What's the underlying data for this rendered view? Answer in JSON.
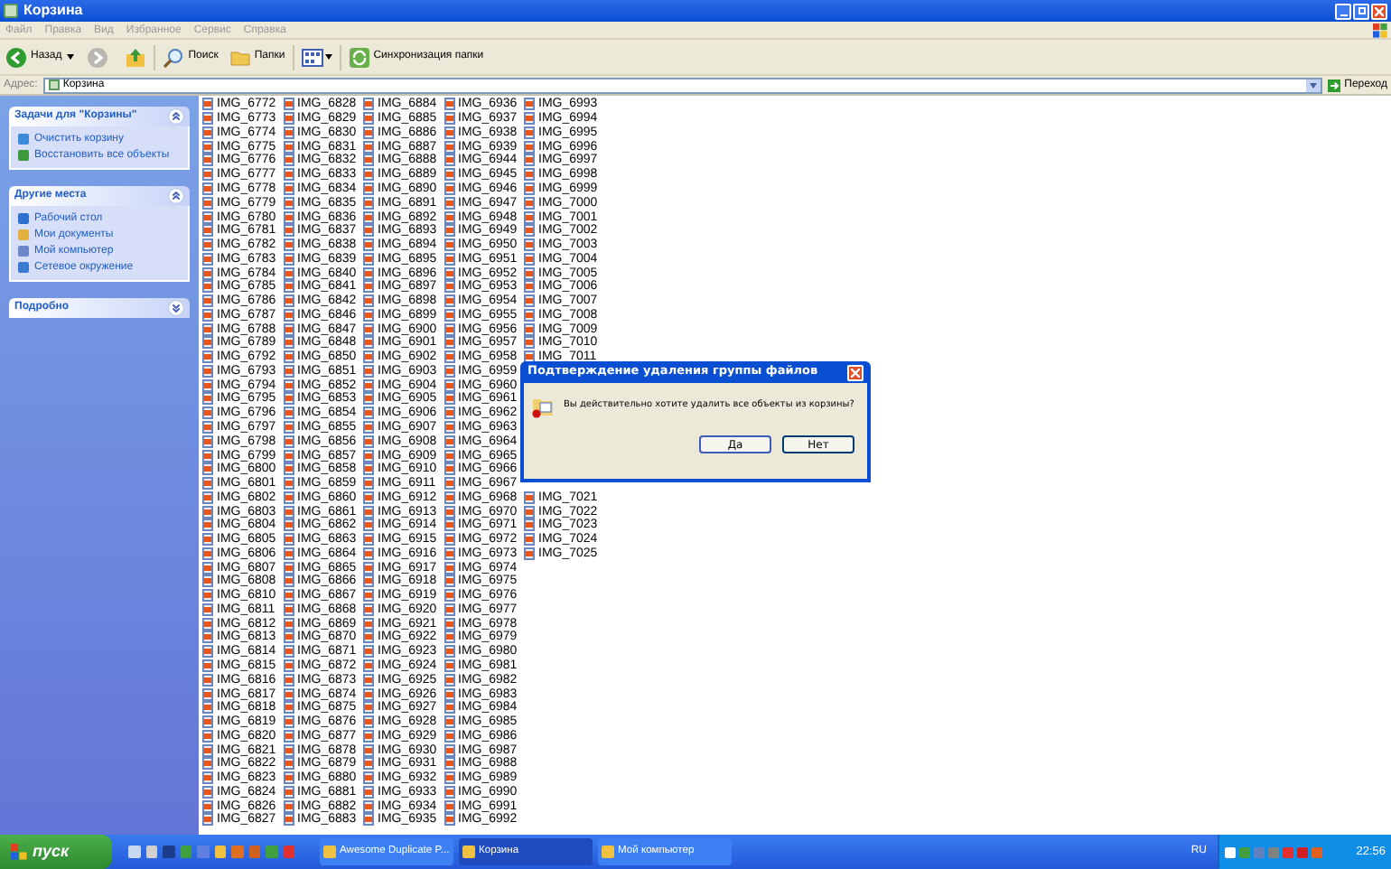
{
  "window": {
    "title": "Корзина"
  },
  "menu": [
    "Файл",
    "Правка",
    "Вид",
    "Избранное",
    "Сервис",
    "Справка"
  ],
  "toolbar": {
    "back": "Назад",
    "search": "Поиск",
    "folders": "Папки",
    "sync": "Синхронизация папки"
  },
  "address": {
    "label": "Адрес:",
    "value": "Корзина",
    "go": "Переход"
  },
  "sidebar": [
    {
      "title": "Задачи для \"Корзины\"",
      "expanded": true,
      "items": [
        "Очистить корзину",
        "Восстановить все объекты"
      ]
    },
    {
      "title": "Другие места",
      "expanded": true,
      "items": [
        "Рабочий стол",
        "Мои документы",
        "Мой компьютер",
        "Сетевое окружение"
      ]
    },
    {
      "title": "Подробно",
      "expanded": false
    }
  ],
  "columns": [
    {
      "files": [
        "IMG_6772",
        "IMG_6773",
        "IMG_6774",
        "IMG_6775",
        "IMG_6776",
        "IMG_6777",
        "IMG_6778",
        "IMG_6779",
        "IMG_6780",
        "IMG_6781",
        "IMG_6782",
        "IMG_6783",
        "IMG_6784",
        "IMG_6785",
        "IMG_6786",
        "IMG_6787",
        "IMG_6788",
        "IMG_6789",
        "IMG_6792",
        "IMG_6793",
        "IMG_6794",
        "IMG_6795",
        "IMG_6796",
        "IMG_6797",
        "IMG_6798",
        "IMG_6799",
        "IMG_6800",
        "IMG_6801",
        "IMG_6802",
        "IMG_6803",
        "IMG_6804",
        "IMG_6805",
        "IMG_6806",
        "IMG_6807",
        "IMG_6808",
        "IMG_6810",
        "IMG_6811",
        "IMG_6812",
        "IMG_6813",
        "IMG_6814",
        "IMG_6815",
        "IMG_6816",
        "IMG_6817",
        "IMG_6818",
        "IMG_6819",
        "IMG_6820",
        "IMG_6821",
        "IMG_6822",
        "IMG_6823",
        "IMG_6824",
        "IMG_6826",
        "IMG_6827"
      ]
    },
    {
      "files": [
        "IMG_6828",
        "IMG_6829",
        "IMG_6830",
        "IMG_6831",
        "IMG_6832",
        "IMG_6833",
        "IMG_6834",
        "IMG_6835",
        "IMG_6836",
        "IMG_6837",
        "IMG_6838",
        "IMG_6839",
        "IMG_6840",
        "IMG_6841",
        "IMG_6842",
        "IMG_6846",
        "IMG_6847",
        "IMG_6848",
        "IMG_6850",
        "IMG_6851",
        "IMG_6852",
        "IMG_6853",
        "IMG_6854",
        "IMG_6855",
        "IMG_6856",
        "IMG_6857",
        "IMG_6858",
        "IMG_6859",
        "IMG_6860",
        "IMG_6861",
        "IMG_6862",
        "IMG_6863",
        "IMG_6864",
        "IMG_6865",
        "IMG_6866",
        "IMG_6867",
        "IMG_6868",
        "IMG_6869",
        "IMG_6870",
        "IMG_6871",
        "IMG_6872",
        "IMG_6873",
        "IMG_6874",
        "IMG_6875",
        "IMG_6876",
        "IMG_6877",
        "IMG_6878",
        "IMG_6879",
        "IMG_6880",
        "IMG_6881",
        "IMG_6882",
        "IMG_6883"
      ]
    },
    {
      "files": [
        "IMG_6884",
        "IMG_6885",
        "IMG_6886",
        "IMG_6887",
        "IMG_6888",
        "IMG_6889",
        "IMG_6890",
        "IMG_6891",
        "IMG_6892",
        "IMG_6893",
        "IMG_6894",
        "IMG_6895",
        "IMG_6896",
        "IMG_6897",
        "IMG_6898",
        "IMG_6899",
        "IMG_6900",
        "IMG_6901",
        "IMG_6902",
        "IMG_6903",
        "IMG_6904",
        "IMG_6905",
        "IMG_6906",
        "IMG_6907",
        "IMG_6908",
        "IMG_6909",
        "IMG_6910",
        "IMG_6911",
        "IMG_6912",
        "IMG_6913",
        "IMG_6914",
        "IMG_6915",
        "IMG_6916",
        "IMG_6917",
        "IMG_6918",
        "IMG_6919",
        "IMG_6920",
        "IMG_6921",
        "IMG_6922",
        "IMG_6923",
        "IMG_6924",
        "IMG_6925",
        "IMG_6926",
        "IMG_6927",
        "IMG_6928",
        "IMG_6929",
        "IMG_6930",
        "IMG_6931",
        "IMG_6932",
        "IMG_6933",
        "IMG_6934",
        "IMG_6935"
      ]
    },
    {
      "files": [
        "IMG_6936",
        "IMG_6937",
        "IMG_6938",
        "IMG_6939",
        "IMG_6944",
        "IMG_6945",
        "IMG_6946",
        "IMG_6947",
        "IMG_6948",
        "IMG_6949",
        "IMG_6950",
        "IMG_6951",
        "IMG_6952",
        "IMG_6953",
        "IMG_6954",
        "IMG_6955",
        "IMG_6956",
        "IMG_6957",
        "IMG_6958",
        "IMG_6959",
        "IMG_6960",
        "IMG_6961",
        "IMG_6962",
        "IMG_6963",
        "IMG_6964",
        "IMG_6965",
        "IMG_6966",
        "IMG_6967",
        "IMG_6968",
        "IMG_6970",
        "IMG_6971",
        "IMG_6972",
        "IMG_6973",
        "IMG_6974",
        "IMG_6975",
        "IMG_6976",
        "IMG_6977",
        "IMG_6978",
        "IMG_6979",
        "IMG_6980",
        "IMG_6981",
        "IMG_6982",
        "IMG_6983",
        "IMG_6984",
        "IMG_6985",
        "IMG_6986",
        "IMG_6987",
        "IMG_6988",
        "IMG_6989",
        "IMG_6990",
        "IMG_6991",
        "IMG_6992"
      ]
    },
    {
      "files": [
        "IMG_6993",
        "IMG_6994",
        "IMG_6995",
        "IMG_6996",
        "IMG_6997",
        "IMG_6998",
        "IMG_6999",
        "IMG_7000",
        "IMG_7001",
        "IMG_7002",
        "IMG_7003",
        "IMG_7004",
        "IMG_7005",
        "IMG_7006",
        "IMG_7007",
        "IMG_7008",
        "IMG_7009",
        "IMG_7010",
        "IMG_7011"
      ],
      "files_below_dialog": [
        "IMG_7021",
        "IMG_7022",
        "IMG_7023",
        "IMG_7024",
        "IMG_7025"
      ]
    }
  ],
  "dialog": {
    "title": "Подтверждение удаления группы файлов",
    "message": "Вы действительно хотите удалить все объекты из корзины?",
    "buttons": [
      "Да",
      "Нет"
    ]
  },
  "taskbar": {
    "start": "пуск",
    "tasks": [
      {
        "label": "Awesome Duplicate P...",
        "selected": false
      },
      {
        "label": "Корзина",
        "selected": true
      },
      {
        "label": "Мой компьютер",
        "selected": false
      }
    ],
    "language": "RU",
    "clock": "22:56"
  }
}
